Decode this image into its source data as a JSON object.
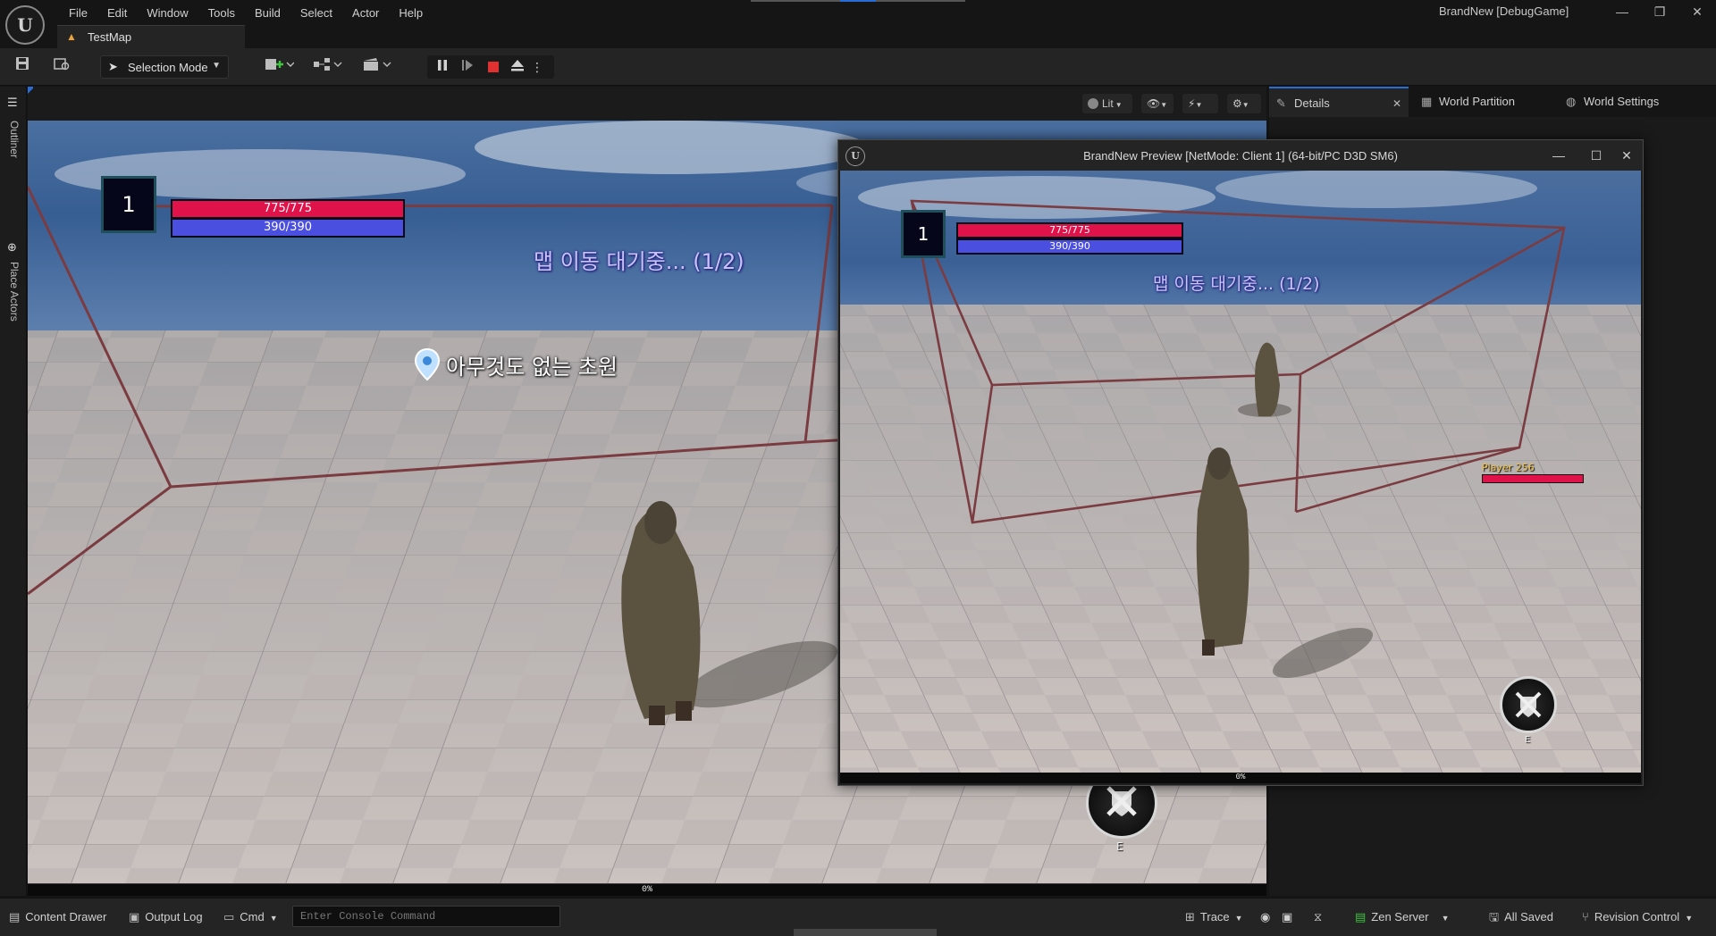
{
  "titlebar": {
    "logo_letter": "U",
    "menu": [
      "File",
      "Edit",
      "Window",
      "Tools",
      "Build",
      "Select",
      "Actor",
      "Help"
    ],
    "app_title": "BrandNew [DebugGame]",
    "minimize": "—",
    "restore": "❐",
    "close": "✕"
  },
  "doc_tab": {
    "label": "TestMap",
    "icon": "level-icon"
  },
  "toolbar": {
    "selection_mode": "Selection Mode"
  },
  "left_strip": {
    "outliner": "Outliner",
    "place_actors": "Place Actors"
  },
  "viewport": {
    "view_mode": "Lit",
    "progress_label": "0%",
    "hud": {
      "level": "1",
      "hp": "775/775",
      "mp": "390/390",
      "message": "맵 이동 대기중... (1/2)",
      "location": "아무것도 없는 초원",
      "skill_key": "E"
    }
  },
  "right_panel": {
    "tabs": [
      "Details",
      "World Partition",
      "World Settings"
    ],
    "close": "✕"
  },
  "preview": {
    "title": "BrandNew Preview [NetMode: Client 1]  (64-bit/PC D3D SM6)",
    "logo_letter": "U",
    "minimize": "—",
    "maximize": "☐",
    "close": "✕",
    "progress_label": "0%",
    "hud": {
      "level": "1",
      "hp": "775/775",
      "mp": "390/390",
      "message": "맵 이동 대기중... (1/2)",
      "player_name": "Player 256",
      "skill_key": "E"
    }
  },
  "statusbar": {
    "content_drawer": "Content Drawer",
    "output_log": "Output Log",
    "cmd": "Cmd",
    "console_placeholder": "Enter Console Command",
    "trace": "Trace",
    "zen_server": "Zen Server",
    "all_saved": "All Saved",
    "revision_control": "Revision Control"
  },
  "colors": {
    "accent": "#2a6cd6",
    "hp": "#e0124a",
    "mp": "#4a4fe0",
    "stop": "#e03030"
  }
}
